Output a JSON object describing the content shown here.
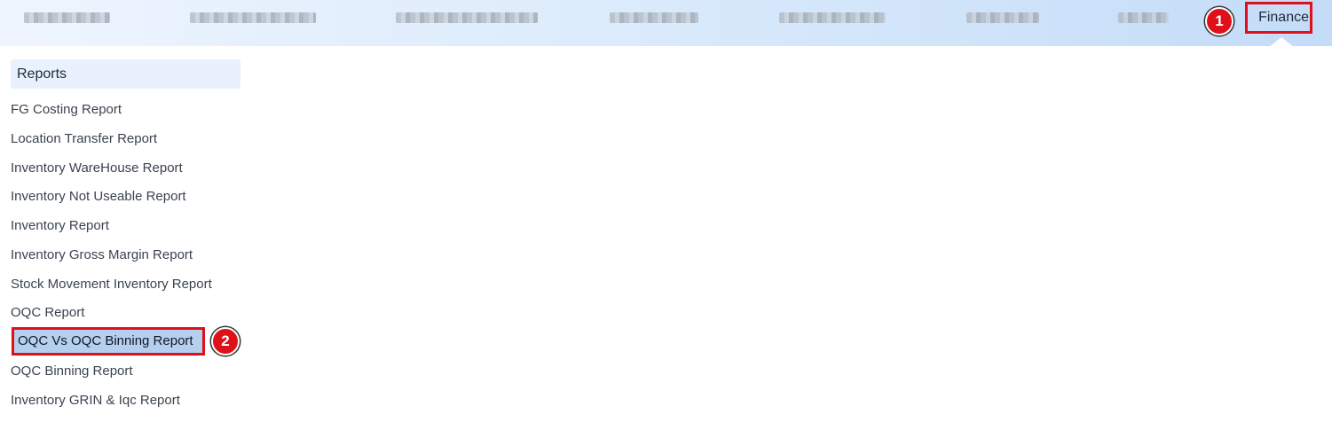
{
  "top_nav": {
    "blurred_item_count": 7,
    "finance_label": "Finance"
  },
  "steps": {
    "one": "1",
    "two": "2"
  },
  "sidebar": {
    "section_title": "Reports",
    "items": [
      {
        "label": "FG Costing Report"
      },
      {
        "label": "Location Transfer Report"
      },
      {
        "label": "Inventory WareHouse Report"
      },
      {
        "label": "Inventory Not Useable Report"
      },
      {
        "label": "Inventory Report"
      },
      {
        "label": "Inventory Gross Margin Report"
      },
      {
        "label": "Stock Movement Inventory Report"
      },
      {
        "label": "OQC Report"
      },
      {
        "label": "OQC Vs OQC Binning Report",
        "highlighted": true
      },
      {
        "label": "OQC Binning Report"
      },
      {
        "label": "Inventory GRIN & Iqc Report"
      }
    ]
  },
  "colors": {
    "highlight_border": "#e0101a",
    "highlight_fill": "#b5d0ee",
    "badge": "#e0101a"
  }
}
